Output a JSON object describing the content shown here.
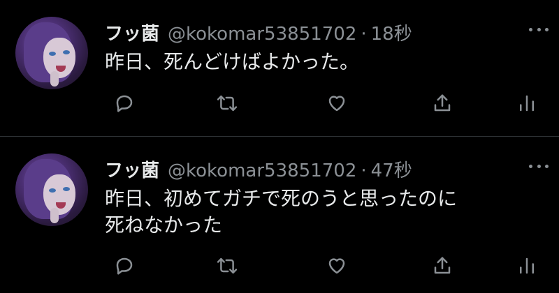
{
  "tweets": [
    {
      "name": "フッ菌",
      "handle": "@kokomar53851702",
      "separator": "·",
      "time": "18秒",
      "text_lines": [
        "昨日、死んどけばよかった。"
      ]
    },
    {
      "name": "フッ菌",
      "handle": "@kokomar53851702",
      "separator": "·",
      "time": "47秒",
      "text_lines": [
        "昨日、初めてガチで死のうと思ったのに",
        "死ねなかった"
      ]
    }
  ],
  "icons": {
    "reply": "reply-icon",
    "retweet": "retweet-icon",
    "like": "heart-icon",
    "share": "share-icon",
    "analytics": "analytics-icon",
    "more": "more-icon"
  },
  "colors": {
    "background": "#000000",
    "text": "#e7e9ea",
    "secondary": "#8b9095",
    "divider": "#2f3336"
  }
}
